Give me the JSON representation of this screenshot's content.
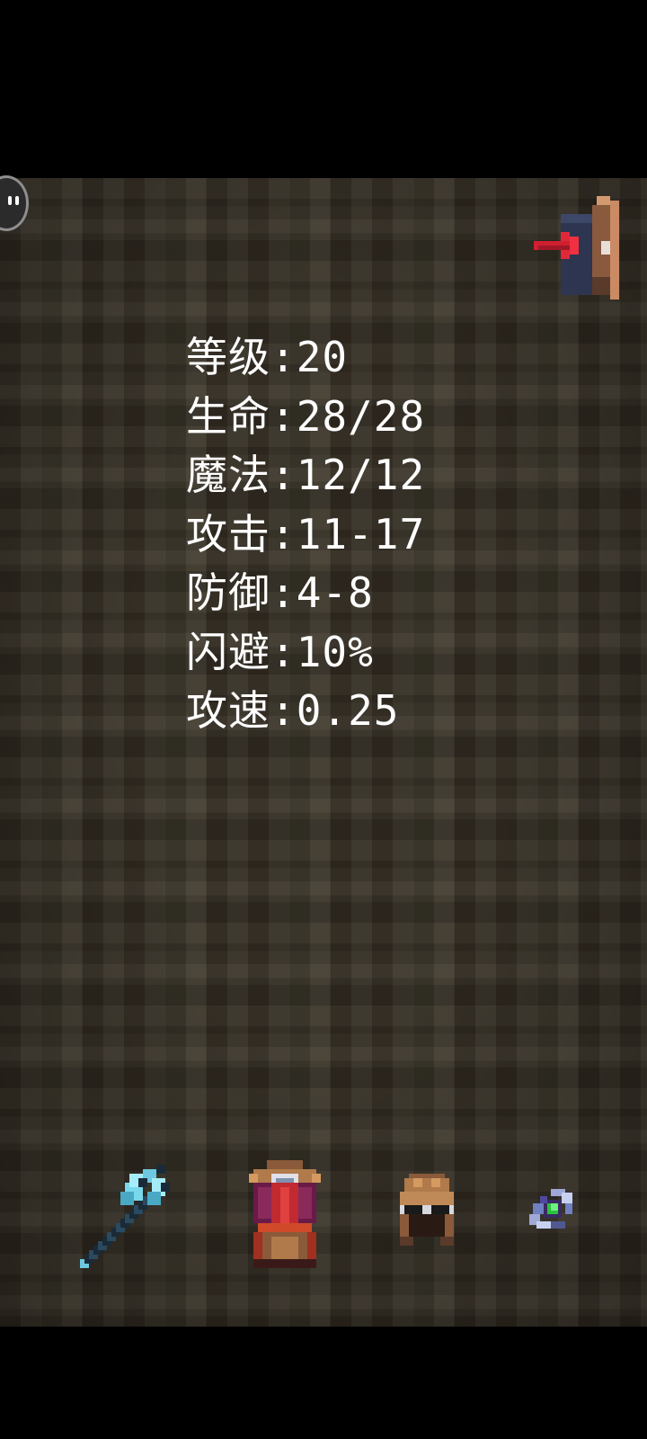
{
  "stats": [
    {
      "label": "等级",
      "value": "20"
    },
    {
      "label": "生命",
      "value": "28/28"
    },
    {
      "label": "魔法",
      "value": "12/12"
    },
    {
      "label": "攻击",
      "value": "11-17"
    },
    {
      "label": "防御",
      "value": "4-8"
    },
    {
      "label": "闪避",
      "value": "10%"
    },
    {
      "label": "攻速",
      "value": "0.25"
    }
  ],
  "separator": ":",
  "icons": {
    "chat": "chat-bubble-icon",
    "exit": "exit-door-icon",
    "weapon": "battle-axe-icon",
    "armor": "robe-armor-icon",
    "helmet": "leather-helmet-icon",
    "ring": "gem-ring-icon"
  },
  "colors": {
    "background": "#3a3428",
    "text": "#ffffff",
    "letterbox": "#000000"
  }
}
